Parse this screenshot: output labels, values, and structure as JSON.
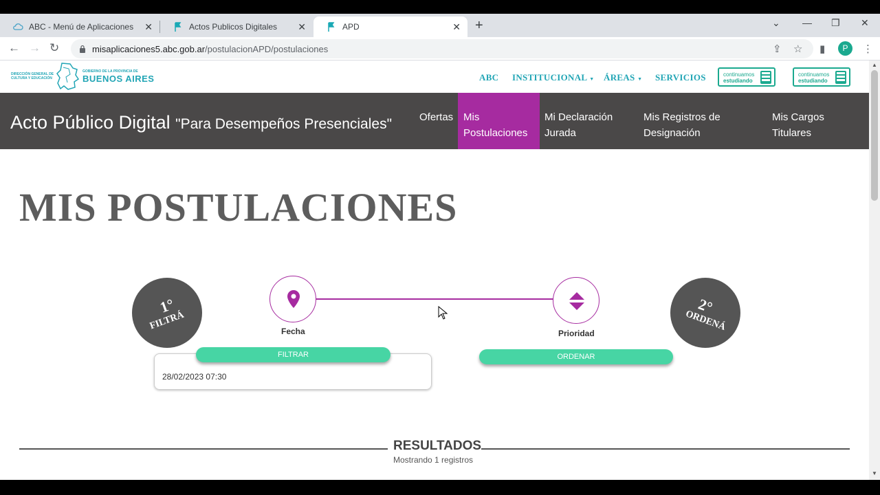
{
  "browser": {
    "tabs": [
      {
        "title": "ABC - Menú de Aplicaciones"
      },
      {
        "title": "Actos Publicos Digitales"
      },
      {
        "title": "APD"
      }
    ],
    "url_host": "misaplicaciones5.abc.gob.ar",
    "url_path": "/postulacionAPD/postulaciones",
    "profile_initial": "P"
  },
  "site": {
    "logo_line1": "DIRECCIÓN GENERAL DE CULTURA Y EDUCACIÓN",
    "logo_gov": "GOBIERNO DE LA PROVINCIA DE",
    "logo_big": "BUENOS AIRES",
    "nav": [
      "ABC",
      "INSTITUCIONAL",
      "ÁREAS",
      "SERVICIOS"
    ],
    "badge_line1": "continuamos",
    "badge_line2": "estudiando"
  },
  "apd": {
    "title": "Acto Público Digital",
    "subtitle": "\"Para Desempeños Presenciales\"",
    "nav": [
      {
        "line1": "Ofertas",
        "line2": ""
      },
      {
        "line1": "Mis",
        "line2": "Postulaciones"
      },
      {
        "line1": "Mi Declaración",
        "line2": "Jurada"
      },
      {
        "line1": "Mis Registros de",
        "line2": "Designación"
      },
      {
        "line1": "Mis Cargos",
        "line2": "Titulares"
      }
    ]
  },
  "main": {
    "page_title": "MIS POSTULACIONES",
    "step1_num": "1°",
    "step1_word": "FILTRÁ",
    "step2_num": "2°",
    "step2_word": "ORDENÁ",
    "fecha_label": "Fecha",
    "prioridad_label": "Prioridad",
    "filtrar_label": "FILTRAR",
    "ordenar_label": "ORDENAR",
    "filter_value": "28/02/2023 07:30",
    "results_title": "RESULTADOS",
    "results_sub": "Mostrando 1 registros"
  },
  "colors": {
    "accent_purple": "#a62ba0",
    "button_green": "#47d5a4",
    "brand_teal": "#21a5b5",
    "dark_nav": "#4a4848"
  }
}
